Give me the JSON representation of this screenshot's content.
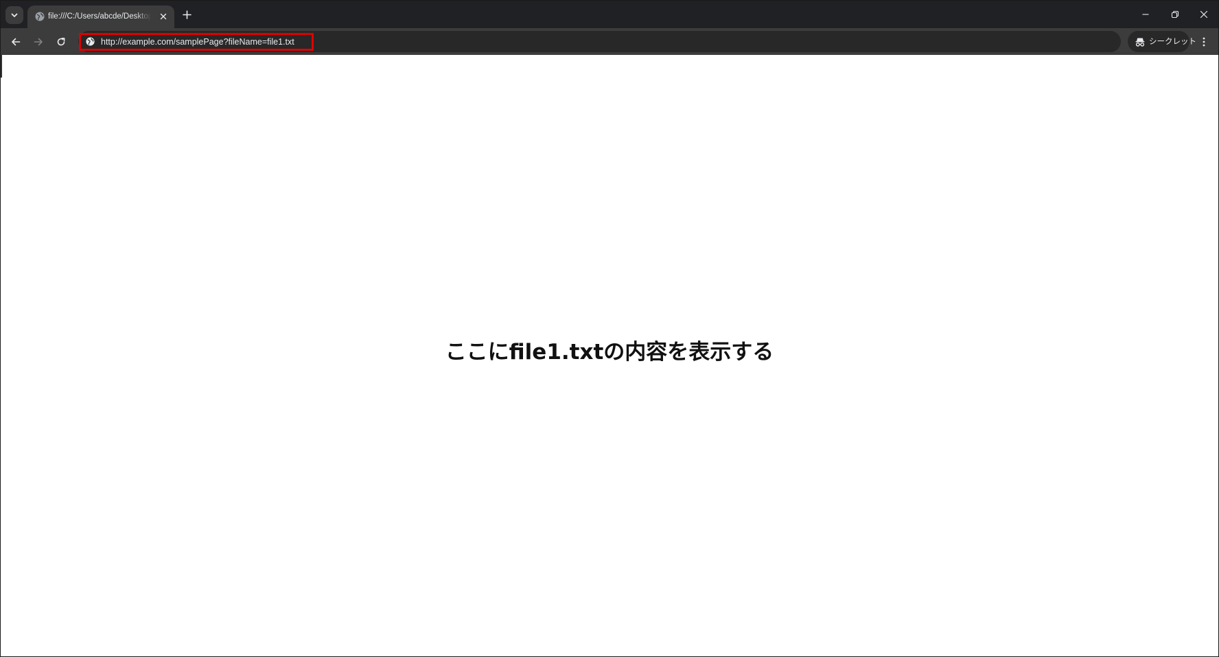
{
  "browser": {
    "tab": {
      "title": "file:///C:/Users/abcde/Desktop/"
    },
    "address_bar": {
      "url": "http://example.com/samplePage?fileName=file1.txt"
    },
    "profile": {
      "label": "シークレット"
    },
    "icons": {
      "tab_search": "chevron-down-icon",
      "favicon": "globe-icon",
      "tab_close": "close-icon",
      "new_tab": "plus-icon",
      "back": "arrow-left-icon",
      "forward": "arrow-right-icon",
      "reload": "reload-icon",
      "site_info": "globe-icon",
      "incognito": "incognito-icon",
      "menu": "kebab-menu-icon",
      "minimize": "minimize-icon",
      "restore": "restore-icon",
      "close_window": "close-icon"
    },
    "colors": {
      "tabstrip": "#202124",
      "toolbar": "#3c3c3c",
      "omnibox": "#282828",
      "highlight": "#e00000"
    }
  },
  "page": {
    "message": "ここにfile1.txtの内容を表示する"
  }
}
